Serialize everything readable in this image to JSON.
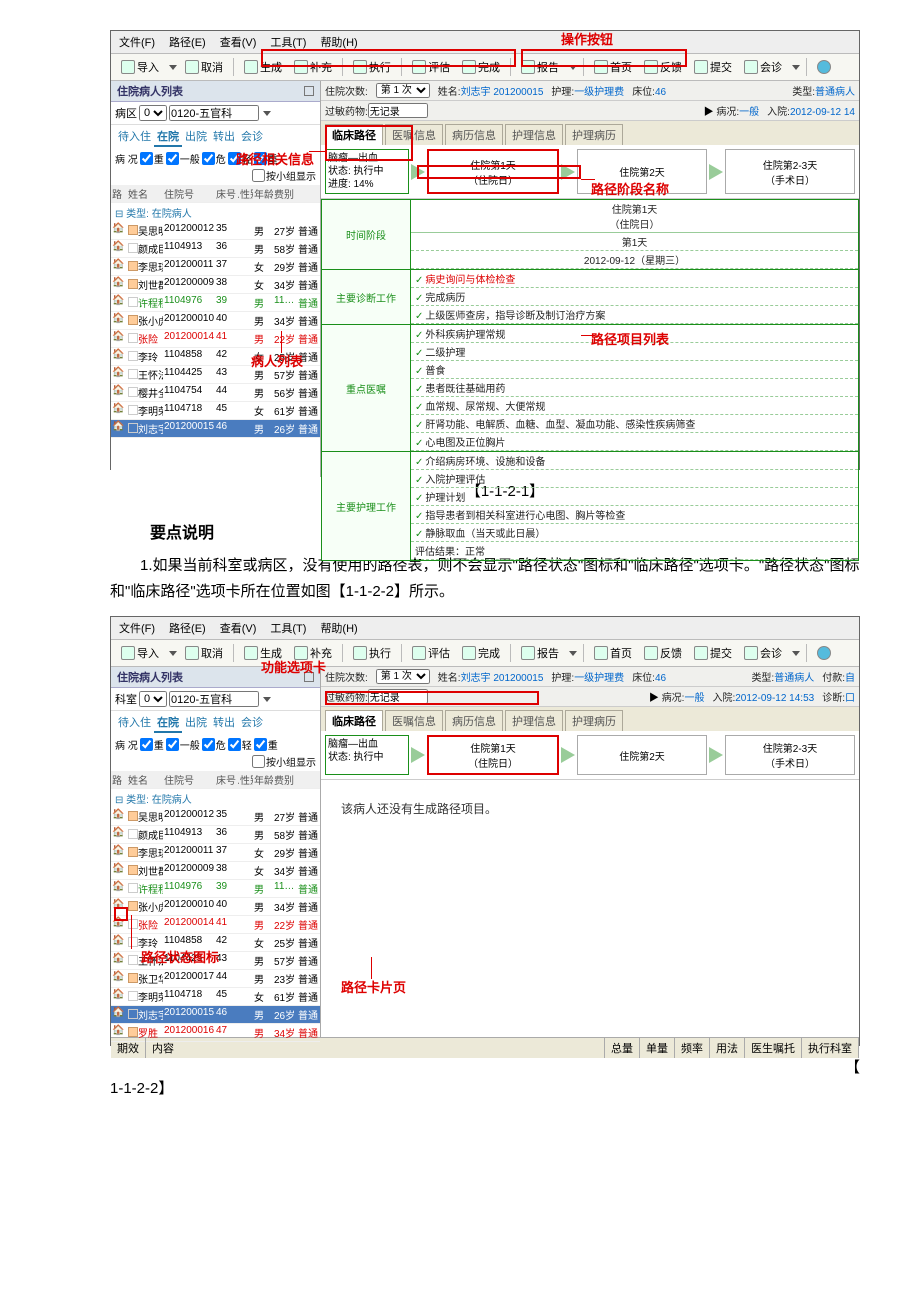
{
  "menus": [
    "文件(F)",
    "路径(E)",
    "查看(V)",
    "工具(T)",
    "帮助(H)"
  ],
  "toolbar": {
    "import": "导入",
    "cancel": "取消",
    "gen": "生成",
    "supp": "补充",
    "exec": "执行",
    "eval": "评估",
    "done": "完成",
    "report": "报告",
    "home": "首页",
    "feedback": "反馈",
    "order": "提交",
    "consult": "会诊",
    "help": "?"
  },
  "leftPanel": {
    "title": "住院病人列表",
    "wardLabel": "病区",
    "wardCode": "0120-五官科",
    "statusTabs": [
      "待入住",
      "在院",
      "出院",
      "转出",
      "会诊"
    ],
    "statusActive": 1,
    "condLabel": "病 况",
    "condOpts": [
      "重",
      "一般",
      "危",
      "轻",
      "重"
    ],
    "groupChk": "按小组显示",
    "cols": [
      "路",
      "姓名",
      "住院号",
      "床号",
      "性别",
      "年龄",
      "费别"
    ],
    "sortArrow": "▲",
    "typeLabel": "类型: 在院病人"
  },
  "patients": [
    {
      "name": "吴思明",
      "id": "201200012",
      "bed": "35",
      "sex": "男",
      "age": "27岁",
      "fee": "普通",
      "ico": "g"
    },
    {
      "name": "颜成臣",
      "id": "1104913",
      "bed": "36",
      "sex": "男",
      "age": "58岁",
      "fee": "普通",
      "ico": ""
    },
    {
      "name": "李思琪",
      "id": "201200011",
      "bed": "37",
      "sex": "女",
      "age": "29岁",
      "fee": "普通",
      "ico": "g"
    },
    {
      "name": "刘世群",
      "id": "201200009",
      "bed": "38",
      "sex": "女",
      "age": "34岁",
      "fee": "普通",
      "ico": "g"
    },
    {
      "name": "许程程",
      "id": "1104976",
      "bed": "39",
      "sex": "男",
      "age": "11…",
      "fee": "普通",
      "cls": "green"
    },
    {
      "name": "张小虎",
      "id": "201200010",
      "bed": "40",
      "sex": "男",
      "age": "34岁",
      "fee": "普通",
      "ico": "g"
    },
    {
      "name": "张险",
      "id": "201200014",
      "bed": "41",
      "sex": "男",
      "age": "22岁",
      "fee": "普通",
      "cls": "red"
    },
    {
      "name": "李玲",
      "id": "1104858",
      "bed": "42",
      "sex": "女",
      "age": "25岁",
      "fee": "普通",
      "ico": ""
    },
    {
      "name": "王怀法",
      "id": "1104425",
      "bed": "43",
      "sex": "男",
      "age": "57岁",
      "fee": "普通",
      "ico": ""
    },
    {
      "name": "樱井全",
      "id": "1104754",
      "bed": "44",
      "sex": "男",
      "age": "56岁",
      "fee": "普通",
      "ico": ""
    },
    {
      "name": "李明荣",
      "id": "1104718",
      "bed": "45",
      "sex": "女",
      "age": "61岁",
      "fee": "普通",
      "ico": ""
    },
    {
      "name": "刘志宇",
      "id": "201200015",
      "bed": "46",
      "sex": "男",
      "age": "26岁",
      "fee": "普通",
      "cls": "hlrow"
    }
  ],
  "patients2_extra": [
    {
      "name": "张卫华",
      "id": "201200017",
      "bed": "44",
      "sex": "男",
      "age": "23岁",
      "fee": "普通",
      "ico": "g"
    },
    {
      "name": "李明荣",
      "id": "1104718",
      "bed": "45",
      "sex": "女",
      "age": "61岁",
      "fee": "普通",
      "ico": ""
    },
    {
      "name": "刘志宇",
      "id": "201200015",
      "bed": "46",
      "sex": "男",
      "age": "26岁",
      "fee": "普通",
      "cls": "hlrow"
    },
    {
      "name": "罗胜",
      "id": "201200016",
      "bed": "47",
      "sex": "男",
      "age": "34岁",
      "fee": "普通",
      "ico": "g",
      "cls": "red"
    }
  ],
  "info": {
    "visitLabel": "住院次数",
    "visit": "第 1 次",
    "nameLabel": "姓名:",
    "name": "刘志宇 201200015",
    "careLabel": "护理:",
    "care": "一级护理费",
    "bedLabel": "床位:",
    "bed": "46",
    "typeLabel": "类型:",
    "type": "普通病人",
    "allergyLabel": "过敏药物:",
    "allergy": "无记录",
    "condLabel": "病况:",
    "cond": "一般",
    "admitLabel": "入院:",
    "admit": "2012-09-12 14",
    "admit2": "2012-09-12 14:53",
    "diagLabel": "诊断:",
    "chargeLabel": "付款:",
    "chargeVal": "自"
  },
  "tabs2": [
    "临床路径",
    "医嘱信息",
    "病历信息",
    "护理信息",
    "护理病历"
  ],
  "stage": {
    "diag": "脑瘤—出血",
    "statusK": "状态:",
    "status": "执行中",
    "progressK": "进度:",
    "progress": "14%",
    "boxes": [
      "住院第1天\n（住院日）",
      "住院第2天",
      "住院第2-3天\n（手术日）"
    ]
  },
  "stageHeader": {
    "title": "住院第1天",
    "sub": "（住院日）",
    "day": "第1天",
    "date": "2012-09-12（星期三）"
  },
  "sections": {
    "s1": {
      "label": "时间阶段"
    },
    "s2": {
      "label": "主要诊断工作",
      "items": [
        "病史询问与体检检查",
        "完成病历",
        "上级医师查房，指导诊断及制订治疗方案"
      ]
    },
    "s3": {
      "label": "重点医嘱",
      "items": [
        "外科疾病护理常规",
        "二级护理",
        "普食",
        "患者既往基础用药",
        "血常规、尿常规、大便常规",
        "肝肾功能、电解质、血糖、血型、凝血功能、感染性疾病筛查",
        "心电图及正位胸片"
      ]
    },
    "s4": {
      "label": "主要护理工作",
      "items": [
        "介绍病房环境、设施和设备",
        "入院护理评估",
        "护理计划",
        "指导患者到相关科室进行心电图、胸片等检查",
        "静脉取血（当天或此日晨）"
      ]
    },
    "result": {
      "label": "评估结果：",
      "value": "正常"
    }
  },
  "screenshot2": {
    "empty": "该病人还没有生成路径项目。",
    "orderCols": [
      "期效",
      "内容",
      "总量",
      "单量",
      "频率",
      "用法",
      "医生嘱托",
      "执行科室"
    ]
  },
  "fig1": "【1-1-2-1】",
  "sectionTitle": "要点说明",
  "para1": "1.如果当前科室或病区，没有使用的路径表，则不会显示\"路径状态\"图标和\"临床路径\"选项卡。\"路径状态\"图标和\"临床路径\"选项卡所在位置如图【1-1-2-2】所示。",
  "fig2_pre": "【",
  "fig2_post": "1-1-2-2】",
  "annots": {
    "opBtn": "操作按钮",
    "pathInfo": "路径相关信息",
    "patientList": "病人列表",
    "stageName": "路径阶段名称",
    "itemList": "路径项目列表",
    "funcTab": "功能选项卡",
    "statusIcon": "路径状态图标",
    "cardPage": "路径卡片页"
  }
}
